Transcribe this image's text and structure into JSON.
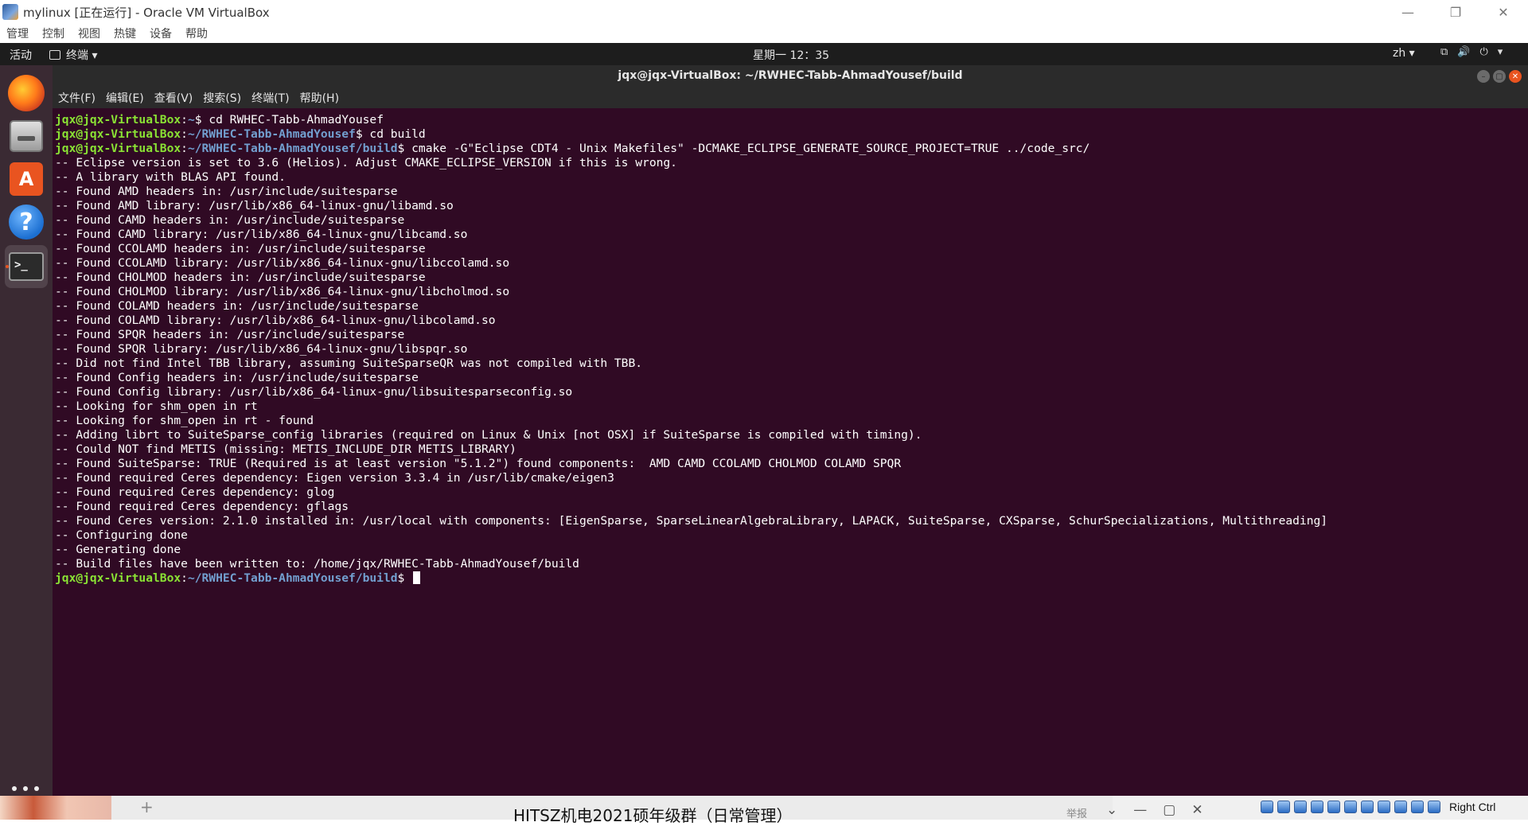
{
  "host_window": {
    "title": "mylinux [正在运行] - Oracle VM VirtualBox",
    "controls": {
      "minimize": "—",
      "restore": "❐",
      "close": "✕"
    },
    "menu": [
      "管理",
      "控制",
      "视图",
      "热键",
      "设备",
      "帮助"
    ]
  },
  "topbar": {
    "activities": "活动",
    "app_menu": "终端 ▾",
    "clock": "星期一 12：35",
    "language": "zh ▾",
    "tray": [
      "⧉",
      "🔊",
      "⏻",
      "▾"
    ]
  },
  "dock": {
    "help_glyph": "?",
    "software_glyph": "A",
    "terminal_glyph": ">_"
  },
  "terminal": {
    "title": "jqx@jqx-VirtualBox: ~/RWHEC-Tabb-AhmadYousef/build",
    "controls": {
      "minimize": "–",
      "maximize": "▢",
      "close": "✕"
    },
    "menu": [
      "文件(F)",
      "编辑(E)",
      "查看(V)",
      "搜索(S)",
      "终端(T)",
      "帮助(H)"
    ],
    "prompt_user": "jqx@jqx-VirtualBox",
    "lines": [
      {
        "path": "~",
        "cmd": "cd RWHEC-Tabb-AhmadYousef"
      },
      {
        "path": "~/RWHEC-Tabb-AhmadYousef",
        "cmd": "cd build"
      },
      {
        "path": "~/RWHEC-Tabb-AhmadYousef/build",
        "cmd": "cmake -G\"Eclipse CDT4 - Unix Makefiles\" -DCMAKE_ECLIPSE_GENERATE_SOURCE_PROJECT=TRUE ../code_src/"
      },
      {
        "text": "-- Eclipse version is set to 3.6 (Helios). Adjust CMAKE_ECLIPSE_VERSION if this is wrong."
      },
      {
        "text": "-- A library with BLAS API found."
      },
      {
        "text": "-- Found AMD headers in: /usr/include/suitesparse"
      },
      {
        "text": "-- Found AMD library: /usr/lib/x86_64-linux-gnu/libamd.so"
      },
      {
        "text": "-- Found CAMD headers in: /usr/include/suitesparse"
      },
      {
        "text": "-- Found CAMD library: /usr/lib/x86_64-linux-gnu/libcamd.so"
      },
      {
        "text": "-- Found CCOLAMD headers in: /usr/include/suitesparse"
      },
      {
        "text": "-- Found CCOLAMD library: /usr/lib/x86_64-linux-gnu/libccolamd.so"
      },
      {
        "text": "-- Found CHOLMOD headers in: /usr/include/suitesparse"
      },
      {
        "text": "-- Found CHOLMOD library: /usr/lib/x86_64-linux-gnu/libcholmod.so"
      },
      {
        "text": "-- Found COLAMD headers in: /usr/include/suitesparse"
      },
      {
        "text": "-- Found COLAMD library: /usr/lib/x86_64-linux-gnu/libcolamd.so"
      },
      {
        "text": "-- Found SPQR headers in: /usr/include/suitesparse"
      },
      {
        "text": "-- Found SPQR library: /usr/lib/x86_64-linux-gnu/libspqr.so"
      },
      {
        "text": "-- Did not find Intel TBB library, assuming SuiteSparseQR was not compiled with TBB."
      },
      {
        "text": "-- Found Config headers in: /usr/include/suitesparse"
      },
      {
        "text": "-- Found Config library: /usr/lib/x86_64-linux-gnu/libsuitesparseconfig.so"
      },
      {
        "text": "-- Looking for shm_open in rt"
      },
      {
        "text": "-- Looking for shm_open in rt - found"
      },
      {
        "text": "-- Adding librt to SuiteSparse_config libraries (required on Linux & Unix [not OSX] if SuiteSparse is compiled with timing)."
      },
      {
        "text": "-- Could NOT find METIS (missing: METIS_INCLUDE_DIR METIS_LIBRARY)"
      },
      {
        "text": "-- Found SuiteSparse: TRUE (Required is at least version \"5.1.2\") found components:  AMD CAMD CCOLAMD CHOLMOD COLAMD SPQR"
      },
      {
        "text": "-- Found required Ceres dependency: Eigen version 3.3.4 in /usr/lib/cmake/eigen3"
      },
      {
        "text": "-- Found required Ceres dependency: glog"
      },
      {
        "text": "-- Found required Ceres dependency: gflags"
      },
      {
        "text": "-- Found Ceres version: 2.1.0 installed in: /usr/local with components: [EigenSparse, SparseLinearAlgebraLibrary, LAPACK, SuiteSparse, CXSparse, SchurSpecializations, Multithreading]"
      },
      {
        "text": "-- Configuring done"
      },
      {
        "text": "-- Generating done"
      },
      {
        "text": "-- Build files have been written to: /home/jqx/RWHEC-Tabb-AhmadYousef/build"
      },
      {
        "path": "~/RWHEC-Tabb-AhmadYousef/build",
        "cmd": "",
        "cursor": true
      }
    ]
  },
  "host_taskbar": {
    "plus": "+",
    "chat_title": "HITSZ机电2021硕年级群（日常管理）",
    "report": "举报",
    "chat_controls": [
      "⌄",
      "—",
      "▢",
      "✕"
    ],
    "host_key": "Right Ctrl"
  },
  "colors": {
    "terminal_bg": "#300a24",
    "prompt_user": "#8ae234",
    "prompt_path": "#729fcf",
    "ubuntu_orange": "#e95420"
  }
}
